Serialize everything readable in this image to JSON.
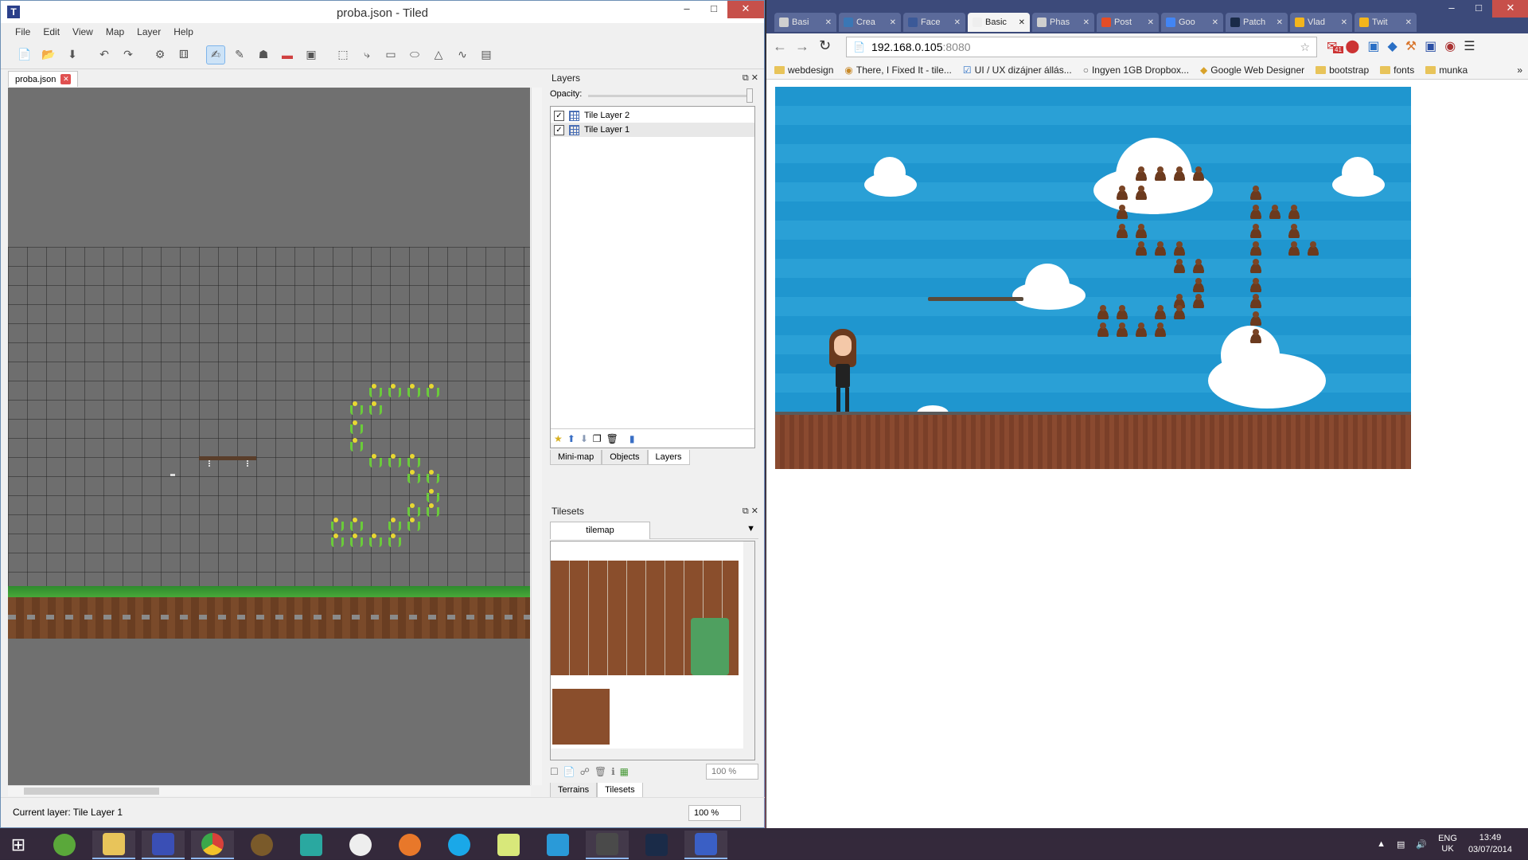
{
  "tiled": {
    "title": "proba.json - Tiled",
    "menu": [
      "File",
      "Edit",
      "View",
      "Map",
      "Layer",
      "Help"
    ],
    "doc_tab": "proba.json",
    "status": "Current layer: Tile Layer 1",
    "zoom": "100 %",
    "layers_dock": {
      "title": "Layers",
      "opacity_label": "Opacity:",
      "layers": [
        {
          "name": "Tile Layer 2",
          "visible": true
        },
        {
          "name": "Tile Layer 1",
          "visible": true,
          "selected": true
        }
      ],
      "tabs": [
        "Mini-map",
        "Objects",
        "Layers"
      ],
      "active_tab": "Layers"
    },
    "tilesets_dock": {
      "title": "Tilesets",
      "selected_tileset": "tilemap",
      "zoom": "100 %",
      "tabs": [
        "Terrains",
        "Tilesets"
      ],
      "active_tab": "Tilesets"
    }
  },
  "chrome": {
    "tabs": [
      {
        "label": "Basi",
        "favicon_color": "#cfcfcf"
      },
      {
        "label": "Crea",
        "favicon_color": "#3a77b5"
      },
      {
        "label": "Face",
        "favicon_color": "#3b5998"
      },
      {
        "label": "Basic",
        "favicon_color": "#eeeeee",
        "active": true
      },
      {
        "label": "Phas",
        "favicon_color": "#cfcfcf"
      },
      {
        "label": "Post",
        "favicon_color": "#e44d26"
      },
      {
        "label": "Goo",
        "favicon_color": "#4285f4"
      },
      {
        "label": "Patch",
        "favicon_color": "#1a2b48"
      },
      {
        "label": "Vlad",
        "favicon_color": "#f2b51c"
      },
      {
        "label": "Twit",
        "favicon_color": "#f2b51c"
      }
    ],
    "url_host": "192.168.0.105",
    "url_port": ":8080",
    "bookmarks": [
      {
        "label": "webdesign",
        "icon": "folder-icon"
      },
      {
        "label": "There, I Fixed It - tile...",
        "icon": "burger-icon"
      },
      {
        "label": "UI / UX dizájner állás...",
        "icon": "check-icon"
      },
      {
        "label": "Ingyen 1GB Dropbox...",
        "icon": "dropbox-icon"
      },
      {
        "label": "Google Web Designer",
        "icon": "gwd-icon"
      },
      {
        "label": "bootstrap",
        "icon": "folder-icon"
      },
      {
        "label": "fonts",
        "icon": "folder-icon"
      },
      {
        "label": "munka",
        "icon": "folder-icon"
      }
    ],
    "gmail_badge": "41"
  },
  "taskbar": {
    "language": "ENG",
    "region": "UK",
    "time": "13:49",
    "date": "03/07/2014"
  },
  "colors": {
    "sky": "#2aa0d6",
    "accent": "#7eb4ea",
    "close": "#c7504a"
  }
}
